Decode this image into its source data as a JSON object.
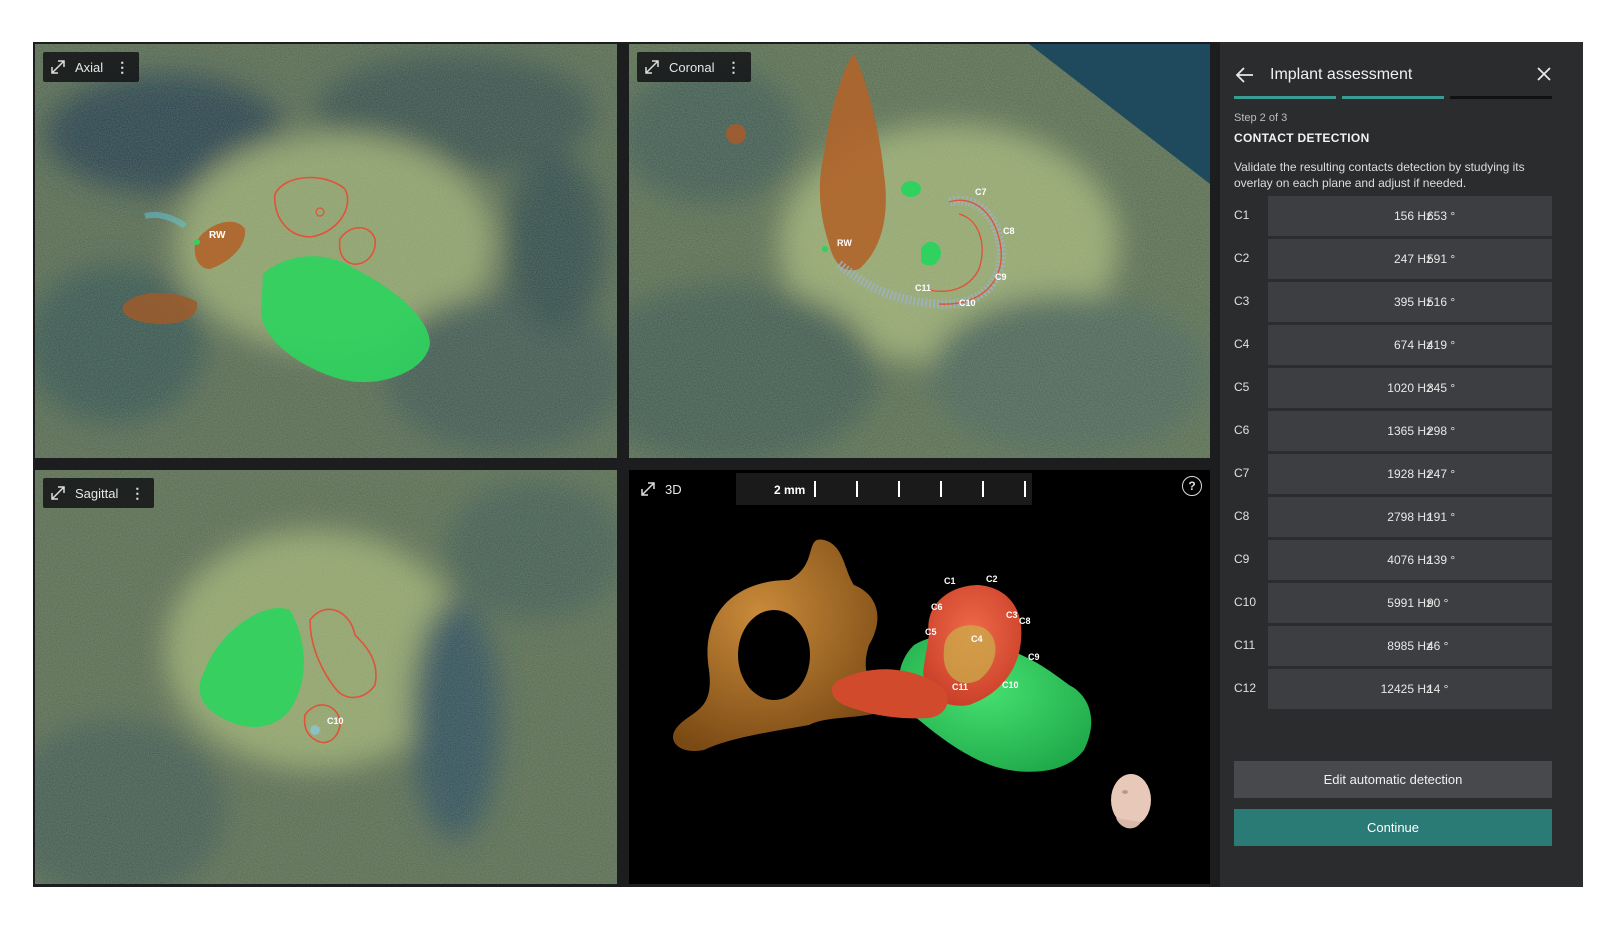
{
  "viewports": {
    "axial": {
      "label": "Axial",
      "markers": [
        "RW"
      ]
    },
    "coronal": {
      "label": "Coronal",
      "markers": [
        "RW",
        "C7",
        "C8",
        "C9",
        "C10",
        "C11"
      ]
    },
    "sagittal": {
      "label": "Sagittal",
      "markers": [
        "C10"
      ]
    },
    "three_d": {
      "label": "3D",
      "scale_label": "2 mm",
      "help": "?",
      "markers": [
        "C1",
        "C2",
        "C3",
        "C4",
        "C6",
        "C8",
        "C9",
        "C10",
        "C11",
        "C5"
      ]
    },
    "menu_glyph": "⋮"
  },
  "panel": {
    "title": "Implant assessment",
    "step_number": "Step 2 of 3",
    "step_title": "CONTACT DETECTION",
    "description": "Validate the resulting contacts detection by studying its overlay on each plane and adjust if needed.",
    "progress": {
      "current_step": 2,
      "total_steps": 3
    },
    "contacts": [
      {
        "id": "C1",
        "frequency": "156 Hz",
        "angle": "653 °"
      },
      {
        "id": "C2",
        "frequency": "247 Hz",
        "angle": "591 °"
      },
      {
        "id": "C3",
        "frequency": "395 Hz",
        "angle": "516 °"
      },
      {
        "id": "C4",
        "frequency": "674 Hz",
        "angle": "419 °"
      },
      {
        "id": "C5",
        "frequency": "1020 Hz",
        "angle": "345 °"
      },
      {
        "id": "C6",
        "frequency": "1365 Hz",
        "angle": "298 °"
      },
      {
        "id": "C7",
        "frequency": "1928 Hz",
        "angle": "247 °"
      },
      {
        "id": "C8",
        "frequency": "2798 Hz",
        "angle": "191 °"
      },
      {
        "id": "C9",
        "frequency": "4076 Hz",
        "angle": "139 °"
      },
      {
        "id": "C10",
        "frequency": "5991 Hz",
        "angle": "90 °"
      },
      {
        "id": "C11",
        "frequency": "8985 Hz",
        "angle": "46 °"
      },
      {
        "id": "C12",
        "frequency": "12425 Hz",
        "angle": "14 °"
      }
    ],
    "edit_button": "Edit automatic detection",
    "continue_button": "Continue"
  },
  "colors": {
    "accent": "#2a7a76",
    "progress_done": "#3a9a94",
    "progress_todo": "#111111",
    "segment_green": "#2ecc5a",
    "segment_brown": "#b0642a",
    "contour_red": "#e0533a",
    "ossicle_orange": "#b5691c"
  },
  "icons": {
    "expand": "expand-icon",
    "menu": "more-vertical-icon",
    "back": "arrow-left-icon",
    "close": "close-icon",
    "help": "help-circle-icon",
    "orientation": "head-orientation-icon"
  }
}
